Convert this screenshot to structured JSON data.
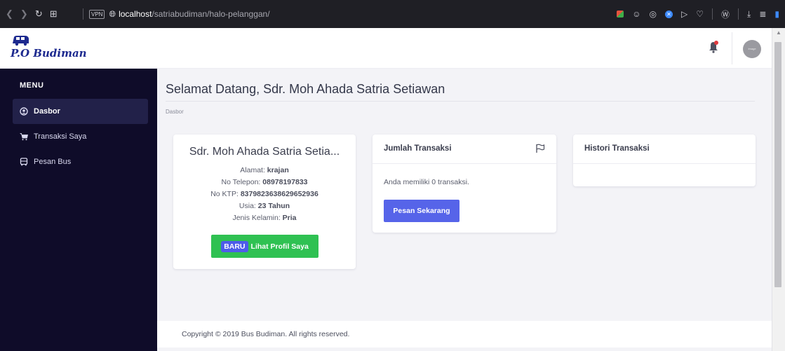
{
  "browser": {
    "url_host": "localhost",
    "url_path": "/satriabudiman/halo-pelanggan/",
    "vpn_label": "VPN",
    "icons": [
      "back-icon",
      "forward-icon",
      "reload-icon",
      "tabs-grid-icon",
      "globe-icon",
      "cube-icon",
      "emoji-icon",
      "camera-icon",
      "shield-icon",
      "play-icon",
      "heart-icon",
      "wallet-icon",
      "download-icon",
      "menu-icon",
      "battery-icon"
    ]
  },
  "header": {
    "logo_text": "P.O Budiman",
    "avatar_label": "Image"
  },
  "sidebar": {
    "title": "MENU",
    "items": [
      {
        "label": "Dasbor",
        "icon": "user-circle-icon",
        "active": true
      },
      {
        "label": "Transaksi Saya",
        "icon": "cart-icon",
        "active": false
      },
      {
        "label": "Pesan Bus",
        "icon": "bus-icon",
        "active": false
      }
    ]
  },
  "main": {
    "title": "Selamat Datang, Sdr. Moh Ahada Satria Setiawan",
    "breadcrumb": "Dasbor"
  },
  "profile": {
    "name": "Sdr. Moh Ahada Satria Setia...",
    "address_label": "Alamat:",
    "address": "krajan",
    "phone_label": "No Telepon:",
    "phone": "08978197833",
    "ktp_label": "No KTP:",
    "ktp": "8379823638629652936",
    "age_label": "Usia:",
    "age": "23 Tahun",
    "gender_label": "Jenis Kelamin:",
    "gender": "Pria",
    "badge": "BARU",
    "button": "Lihat Profil Saya"
  },
  "transactions": {
    "title": "Jumlah Transaksi",
    "text": "Anda memiliki 0 transaksi.",
    "button": "Pesan Sekarang"
  },
  "history": {
    "title": "Histori Transaksi"
  },
  "footer": {
    "text": "Copyright © 2019 Bus Budiman. All rights reserved."
  },
  "colors": {
    "sidebar_bg": "#0f0c29",
    "primary": "#5664e9",
    "success": "#2fc152",
    "page_bg": "#f3f3f7"
  }
}
